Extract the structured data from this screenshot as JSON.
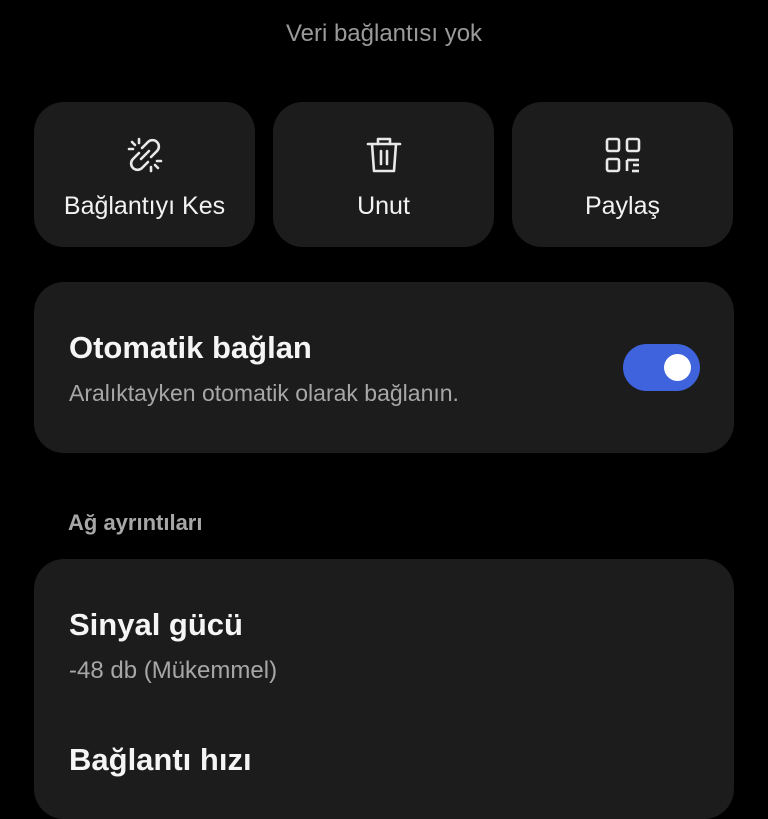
{
  "header": {
    "status_text": "Veri bağlantısı yok"
  },
  "actions": [
    {
      "label": "Bağlantıyı Kes",
      "icon": "unlink-icon"
    },
    {
      "label": "Unut",
      "icon": "trash-icon"
    },
    {
      "label": "Paylaş",
      "icon": "qr-code-icon"
    }
  ],
  "auto_connect": {
    "title": "Otomatik bağlan",
    "subtitle": "Aralıktayken otomatik olarak bağlanın.",
    "enabled": true,
    "toggle_color": "#3e63dd"
  },
  "network_details": {
    "section_title": "Ağ ayrıntıları",
    "items": [
      {
        "title": "Sinyal gücü",
        "value": "-48 db (Mükemmel)"
      },
      {
        "title": "Bağlantı hızı",
        "value": ""
      }
    ]
  }
}
